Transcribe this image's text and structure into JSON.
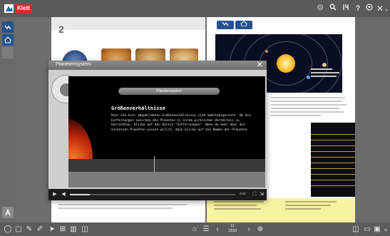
{
  "header": {
    "brand_label": "Klett",
    "icons": [
      "settings-icon",
      "search-icon",
      "tools-icon",
      "help-icon",
      "globe-icon",
      "close-icon",
      "collapse-icon"
    ]
  },
  "left_sidebar": {
    "icons": [
      "chart-icon",
      "home-icon",
      "blank-icon",
      "person-icon"
    ]
  },
  "book": {
    "left_page_number": "2",
    "right_page_chips": [
      "chart-icon",
      "home-icon"
    ]
  },
  "modal": {
    "title": "Planetensystem",
    "pill_label": "Planetensystem",
    "heading": "Größenverhältnisse",
    "body": "Hier die hier abgebildeten Größenverhältnisse sind maßstabsgerecht. Um die Entfernungen zwischen den Planeten in ihrem wirklichen Verhältnis zu betrachten, klicke auf den Button \"Entfernungen\". Wenn du mehr über die einzelnen Planeten wissen willst, dann klicke auf die Namen der Planeten.",
    "time_elapsed": "0:01",
    "progress": 0.12
  },
  "footer": {
    "page_top": "12",
    "page_bottom": "12|13"
  },
  "colors": {
    "accent_blue": "#24528f",
    "brand_red": "#d72b2b",
    "toolbar": "#5a5a5a",
    "highlight_yellow": "#f6f2a0"
  }
}
